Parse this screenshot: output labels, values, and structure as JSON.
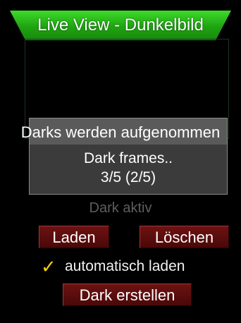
{
  "header": {
    "title": "Live View - Dunkelbild"
  },
  "dialog": {
    "title": "Darks werden aufgenommen",
    "line1": "Dark frames..",
    "line2": "3/5 (2/5)"
  },
  "status": {
    "text": "Dark aktiv"
  },
  "buttons": {
    "load": "Laden",
    "delete": "Löschen",
    "create": "Dark erstellen"
  },
  "auto_load": {
    "label": "automatisch laden",
    "checked": true
  },
  "colors": {
    "banner": "#1fa312",
    "button": "#5a0b0b",
    "check": "#f3d200",
    "dialog_bg": "#3b3b3b"
  }
}
